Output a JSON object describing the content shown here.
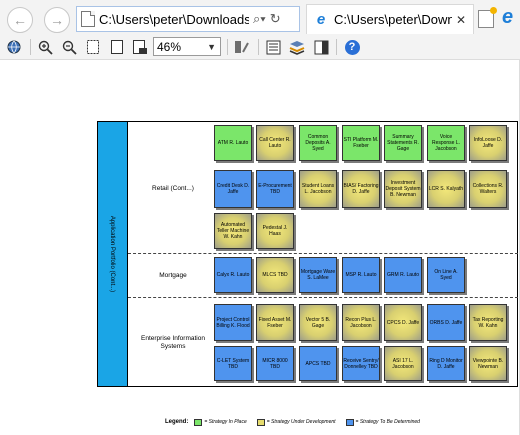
{
  "browser": {
    "address": "C:\\Users\\peter\\Downloads\\F",
    "tab_title": "C:\\Users\\peter\\Downl...",
    "tab_close": "✕"
  },
  "toolbar": {
    "zoom": "46%",
    "help": "?"
  },
  "diagram": {
    "band_label": "Application Portfolio (Cont...)",
    "sections": [
      {
        "label": "Retail (Cont...)"
      },
      {
        "label": "Mortgage"
      },
      {
        "label": "Enterprise Information Systems"
      }
    ],
    "rows": [
      [
        {
          "text": "ATM R. Lauto",
          "status": "green"
        },
        {
          "text": "Call Center R. Lauto",
          "status": "yellow"
        },
        {
          "text": "Common Deposits A. Syed",
          "status": "green"
        },
        {
          "text": "STI Platform M. Fseber",
          "status": "green"
        },
        {
          "text": "Summary Statements R. Gage",
          "status": "green"
        },
        {
          "text": "Voice Response L. Jacobson",
          "status": "green"
        },
        {
          "text": "InfoLoose D. Jaffe",
          "status": "yellow"
        }
      ],
      [
        {
          "text": "Credit Desk D. Jaffe",
          "status": "blue"
        },
        {
          "text": "E-Procurement TBD",
          "status": "blue"
        },
        {
          "text": "Student Loans L. Jacobson",
          "status": "yellow"
        },
        {
          "text": "BIAS/ Factoring D. Jaffe",
          "status": "yellow"
        },
        {
          "text": "Investment Deposit System B. Newman",
          "status": "yellow"
        },
        {
          "text": "LCR S. Kalyath",
          "status": "yellow"
        },
        {
          "text": "Collections R. Walters",
          "status": "yellow"
        }
      ],
      [
        {
          "text": "Automated Teller Machine W. Kahn",
          "status": "yellow"
        },
        {
          "text": "Pedestal J. Haas",
          "status": "yellow"
        }
      ],
      [
        {
          "text": "Calyx R. Lauto",
          "status": "blue"
        },
        {
          "text": "MLCS TBD",
          "status": "yellow"
        },
        {
          "text": "Mortgage Ware S. LaMee",
          "status": "blue"
        },
        {
          "text": "MSP R. Lauto",
          "status": "blue"
        },
        {
          "text": "GRM R. Lauto",
          "status": "blue"
        },
        {
          "text": "On Line A. Syed",
          "status": "blue"
        }
      ],
      [
        {
          "text": "Project Control Billing K. Flood",
          "status": "blue"
        },
        {
          "text": "Fixed Asset M. Fseber",
          "status": "yellow"
        },
        {
          "text": "Vector 5 B. Gage",
          "status": "yellow"
        },
        {
          "text": "Recon Plus L. Jacobson",
          "status": "yellow"
        },
        {
          "text": "CPCS D. Jaffe",
          "status": "yellow"
        },
        {
          "text": "ORBS D. Jaffe",
          "status": "blue"
        },
        {
          "text": "Tax Reporting W. Kahn",
          "status": "yellow"
        }
      ],
      [
        {
          "text": "C-LET System TBD",
          "status": "blue"
        },
        {
          "text": "MICR 8000 TBD",
          "status": "blue"
        },
        {
          "text": "APCS TBD",
          "status": "blue"
        },
        {
          "text": "Receive Sentry/ Donnelley TBD",
          "status": "blue"
        },
        {
          "text": "ASI 17 L. Jacobson",
          "status": "yellow"
        },
        {
          "text": "Ring D Monitor D. Jaffe",
          "status": "blue"
        },
        {
          "text": "Viewpointe B. Newman",
          "status": "yellow"
        }
      ]
    ],
    "legend": {
      "title": "Legend:",
      "items": [
        {
          "label": "= Strategy In Place",
          "color": "#7be66a"
        },
        {
          "label": "= Strategy Under Development",
          "color": "#e6dc6e"
        },
        {
          "label": "= Strategy To Be Determined",
          "color": "#4f94ee"
        }
      ]
    }
  }
}
